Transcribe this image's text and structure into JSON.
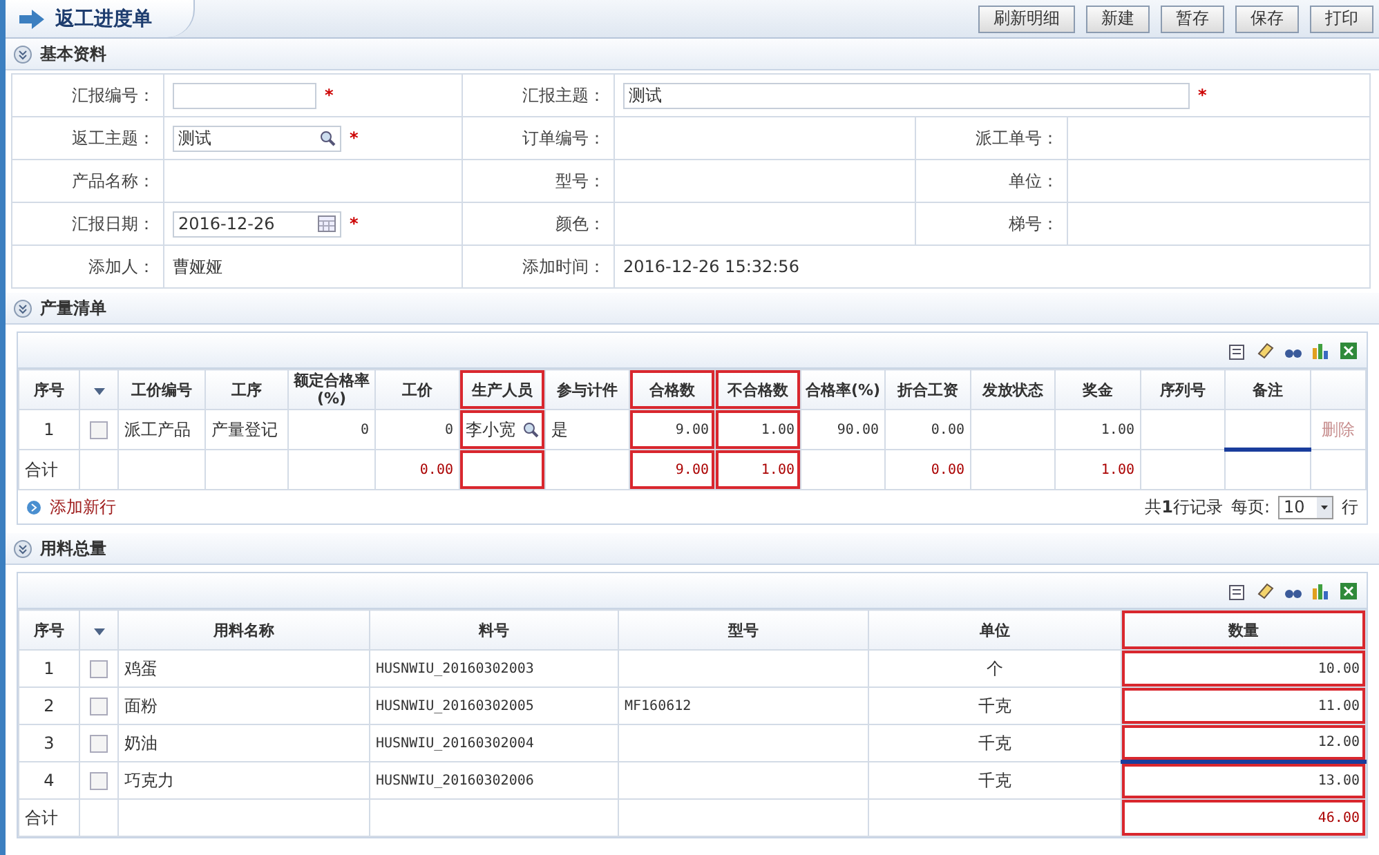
{
  "header": {
    "title": "返工进度单",
    "buttons": [
      "刷新明细",
      "新建",
      "暂存",
      "保存",
      "打印"
    ]
  },
  "basic": {
    "title": "基本资料",
    "rows": [
      [
        {
          "label": "汇报编号：",
          "kind": "input",
          "required": "*"
        },
        {
          "label": "汇报主题：",
          "kind": "input",
          "value": "测试",
          "required": "*",
          "wide": true
        }
      ],
      [
        {
          "label": "返工主题：",
          "kind": "search",
          "value": "测试",
          "required": "*"
        },
        {
          "label": "订单编号："
        },
        {
          "label": "派工单号："
        }
      ],
      [
        {
          "label": "产品名称："
        },
        {
          "label": "型号："
        },
        {
          "label": "单位："
        }
      ],
      [
        {
          "label": "汇报日期：",
          "kind": "date",
          "value": "2016-12-26",
          "required": "*"
        },
        {
          "label": "颜色："
        },
        {
          "label": "梯号："
        }
      ],
      [
        {
          "label": "添加人：",
          "value": "曹娅娅"
        },
        {
          "label": "添加时间：",
          "value": "2016-12-26 15:32:56",
          "wide": true
        }
      ]
    ]
  },
  "output": {
    "title": "产量清单",
    "columns": [
      {
        "label": "序号",
        "highlighted": false
      },
      {
        "highlighted": false
      },
      {
        "label": "工价编号",
        "highlighted": false
      },
      {
        "label": "工序",
        "highlighted": false
      },
      {
        "label": "额定合格率(%)",
        "highlighted": false
      },
      {
        "label": "工价",
        "highlighted": false
      },
      {
        "label": "生产人员",
        "highlighted": true
      },
      {
        "label": "参与计件",
        "highlighted": false
      },
      {
        "label": "合格数",
        "highlighted": true
      },
      {
        "label": "不合格数",
        "highlighted": true
      },
      {
        "label": "合格率(%)",
        "highlighted": false
      },
      {
        "label": "折合工资",
        "highlighted": false
      },
      {
        "label": "发放状态",
        "highlighted": false
      },
      {
        "label": "奖金",
        "highlighted": false
      },
      {
        "label": "序列号",
        "highlighted": false
      },
      {
        "label": "备注",
        "highlighted": false
      },
      {
        "highlighted": false
      }
    ],
    "rows": [
      {
        "no": "1",
        "checked": false,
        "editing": true,
        "code": "派工产品",
        "process": "产量登记",
        "rated": "0",
        "price": "0",
        "worker": "李小宽",
        "piece": "是",
        "good": "9.00",
        "bad": "1.00",
        "rate": "90.00",
        "wage": "0.00",
        "bonus": "1.00",
        "action": "删除"
      }
    ],
    "total": {
      "no": "合计",
      "price": "0.00",
      "good": "9.00",
      "bad": "1.00",
      "wage": "0.00",
      "bonus": "1.00"
    },
    "add_row": "添加新行",
    "pager": {
      "summary": "共**1**行记录",
      "per_page_label": "每页:",
      "per_page": "10",
      "unit": "行"
    }
  },
  "materials": {
    "title": "用料总量",
    "columns": [
      {
        "label": "序号",
        "highlighted": false
      },
      {
        "highlighted": false
      },
      {
        "label": "用料名称",
        "highlighted": false
      },
      {
        "label": "料号",
        "highlighted": false
      },
      {
        "label": "型号",
        "highlighted": false
      },
      {
        "label": "单位",
        "highlighted": false
      },
      {
        "label": "数量",
        "highlighted": true
      }
    ],
    "rows": [
      {
        "no": "1",
        "checked": false,
        "editing": false,
        "name": "鸡蛋",
        "part": "HUSNWIU_20160302003",
        "unit": "个",
        "qty": "10.00"
      },
      {
        "no": "2",
        "checked": false,
        "editing": false,
        "name": "面粉",
        "part": "HUSNWIU_20160302005",
        "model": "MF160612",
        "unit": "千克",
        "qty": "11.00"
      },
      {
        "no": "3",
        "checked": false,
        "editing": true,
        "name": "奶油",
        "part": "HUSNWIU_20160302004",
        "unit": "千克",
        "qty": "12.00"
      },
      {
        "no": "4",
        "checked": false,
        "editing": false,
        "name": "巧克力",
        "part": "HUSNWIU_20160302006",
        "unit": "千克",
        "qty": "13.00"
      }
    ],
    "total": {
      "no": "合计",
      "qty": "46.00"
    }
  }
}
